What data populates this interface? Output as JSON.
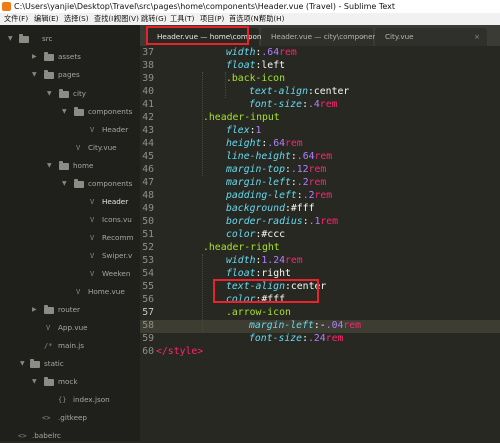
{
  "window": {
    "title": "C:\\Users\\yanjie\\Desktop\\Travel\\src\\pages\\home\\components\\Header.vue (Travel) - Sublime Text"
  },
  "menu": {
    "items": [
      "文件(F)",
      "编辑(E)",
      "选择(S)",
      "查找(I)",
      "视图(V)",
      "跳转(G)",
      "工具(T)",
      "项目(P)",
      "首选项(N)",
      "帮助(H)"
    ]
  },
  "sidebar": {
    "items": [
      {
        "label": "src",
        "kind": "folder",
        "expanded": true
      },
      {
        "label": "assets",
        "kind": "folder",
        "expanded": false
      },
      {
        "label": "pages",
        "kind": "folder",
        "expanded": true
      },
      {
        "label": "city",
        "kind": "folder",
        "expanded": true
      },
      {
        "label": "components",
        "kind": "folder",
        "expanded": true
      },
      {
        "label": "Header",
        "kind": "file",
        "glyph": "V"
      },
      {
        "label": "City.vue",
        "kind": "file",
        "glyph": "V"
      },
      {
        "label": "home",
        "kind": "folder",
        "expanded": true
      },
      {
        "label": "components",
        "kind": "folder",
        "expanded": true
      },
      {
        "label": "Header",
        "kind": "file",
        "glyph": "V",
        "active": true
      },
      {
        "label": "Icons.vu",
        "kind": "file",
        "glyph": "V"
      },
      {
        "label": "Recomm",
        "kind": "file",
        "glyph": "V"
      },
      {
        "label": "Swiper.v",
        "kind": "file",
        "glyph": "V"
      },
      {
        "label": "Weeken",
        "kind": "file",
        "glyph": "V"
      },
      {
        "label": "Home.vue",
        "kind": "file",
        "glyph": "V"
      },
      {
        "label": "router",
        "kind": "folder",
        "expanded": false
      },
      {
        "label": "App.vue",
        "kind": "file",
        "glyph": "V"
      },
      {
        "label": "main.js",
        "kind": "file",
        "glyph": "/*"
      },
      {
        "label": "static",
        "kind": "folder",
        "expanded": true
      },
      {
        "label": "mock",
        "kind": "folder",
        "expanded": true
      },
      {
        "label": "index.json",
        "kind": "file",
        "glyph": "{}"
      },
      {
        "label": ".gitkeep",
        "kind": "file",
        "glyph": "<>"
      },
      {
        "label": ".babelrc",
        "kind": "file",
        "glyph": "<>"
      }
    ]
  },
  "tabs": [
    {
      "label": "Header.vue — home\\components",
      "close": "×",
      "active": true
    },
    {
      "label": "Header.vue — city\\components",
      "close": "×",
      "active": false
    },
    {
      "label": "City.vue",
      "close": "×",
      "active": false
    }
  ],
  "editor": {
    "current_line": "57",
    "lines": [
      {
        "num": "37",
        "tokens": [
          {
            "t": "width",
            "c": "prop"
          },
          {
            "t": ":",
            "c": "punct"
          },
          {
            "t": ".64",
            "c": "num"
          },
          {
            "t": "rem",
            "c": "unit"
          }
        ]
      },
      {
        "num": "38",
        "tokens": [
          {
            "t": "float",
            "c": "prop"
          },
          {
            "t": ":left",
            "c": "val"
          }
        ]
      },
      {
        "num": "39",
        "tokens": [
          {
            "t": ".back-icon",
            "c": "sel"
          }
        ]
      },
      {
        "num": "40",
        "tokens": [
          {
            "t": "text-align",
            "c": "prop"
          },
          {
            "t": ":center",
            "c": "val"
          }
        ]
      },
      {
        "num": "41",
        "tokens": [
          {
            "t": "font-size",
            "c": "prop"
          },
          {
            "t": ":",
            "c": "punct"
          },
          {
            "t": ".4",
            "c": "num"
          },
          {
            "t": "rem",
            "c": "unit"
          }
        ]
      },
      {
        "num": "42",
        "tokens": [
          {
            "t": ".header-input",
            "c": "sel"
          }
        ]
      },
      {
        "num": "43",
        "tokens": [
          {
            "t": "flex",
            "c": "prop"
          },
          {
            "t": ":",
            "c": "punct"
          },
          {
            "t": "1",
            "c": "num"
          }
        ]
      },
      {
        "num": "44",
        "tokens": [
          {
            "t": "height",
            "c": "prop"
          },
          {
            "t": ":",
            "c": "punct"
          },
          {
            "t": ".64",
            "c": "num"
          },
          {
            "t": "rem",
            "c": "unit"
          }
        ]
      },
      {
        "num": "45",
        "tokens": [
          {
            "t": "line-height",
            "c": "prop"
          },
          {
            "t": ":",
            "c": "punct"
          },
          {
            "t": ".64",
            "c": "num"
          },
          {
            "t": "rem",
            "c": "unit"
          }
        ]
      },
      {
        "num": "46",
        "tokens": [
          {
            "t": "margin-top",
            "c": "prop"
          },
          {
            "t": ":",
            "c": "punct"
          },
          {
            "t": ".12",
            "c": "num"
          },
          {
            "t": "rem",
            "c": "unit"
          }
        ]
      },
      {
        "num": "47",
        "tokens": [
          {
            "t": "margin-left",
            "c": "prop"
          },
          {
            "t": ":",
            "c": "punct"
          },
          {
            "t": ".2",
            "c": "num"
          },
          {
            "t": "rem",
            "c": "unit"
          }
        ]
      },
      {
        "num": "48",
        "tokens": [
          {
            "t": "padding-left",
            "c": "prop"
          },
          {
            "t": ":",
            "c": "punct"
          },
          {
            "t": ".2",
            "c": "num"
          },
          {
            "t": "rem",
            "c": "unit"
          }
        ]
      },
      {
        "num": "49",
        "tokens": [
          {
            "t": "background",
            "c": "prop"
          },
          {
            "t": ":#fff",
            "c": "val"
          }
        ]
      },
      {
        "num": "50",
        "tokens": [
          {
            "t": "border-radius",
            "c": "prop"
          },
          {
            "t": ":",
            "c": "punct"
          },
          {
            "t": ".1",
            "c": "num"
          },
          {
            "t": "rem",
            "c": "unit"
          }
        ]
      },
      {
        "num": "51",
        "tokens": [
          {
            "t": "color",
            "c": "prop"
          },
          {
            "t": ":#ccc",
            "c": "val"
          }
        ]
      },
      {
        "num": "52",
        "tokens": [
          {
            "t": ".header-right",
            "c": "sel"
          }
        ]
      },
      {
        "num": "53",
        "tokens": [
          {
            "t": "width",
            "c": "prop"
          },
          {
            "t": ":",
            "c": "punct"
          },
          {
            "t": "1.24",
            "c": "num"
          },
          {
            "t": "rem",
            "c": "unit"
          }
        ]
      },
      {
        "num": "54",
        "tokens": [
          {
            "t": "float",
            "c": "prop"
          },
          {
            "t": ":right",
            "c": "val"
          }
        ]
      },
      {
        "num": "55",
        "tokens": [
          {
            "t": "text-align",
            "c": "prop"
          },
          {
            "t": ":center",
            "c": "val"
          }
        ]
      },
      {
        "num": "56",
        "tokens": [
          {
            "t": "color",
            "c": "prop"
          },
          {
            "t": ":#fff",
            "c": "val"
          }
        ]
      },
      {
        "num": "57",
        "tokens": [
          {
            "t": ".arrow-icon",
            "c": "sel"
          }
        ]
      },
      {
        "num": "58",
        "tokens": [
          {
            "t": "margin-left",
            "c": "prop"
          },
          {
            "t": ":-",
            "c": "punct"
          },
          {
            "t": ".04",
            "c": "num"
          },
          {
            "t": "rem",
            "c": "unit"
          }
        ]
      },
      {
        "num": "59",
        "tokens": [
          {
            "t": "font-size",
            "c": "prop"
          },
          {
            "t": ":",
            "c": "punct"
          },
          {
            "t": ".24",
            "c": "num"
          },
          {
            "t": "rem",
            "c": "unit"
          }
        ]
      },
      {
        "num": "60",
        "tokens": [
          {
            "t": "</",
            "c": "tag"
          },
          {
            "t": "style",
            "c": "tag"
          },
          {
            "t": ">",
            "c": "tag"
          }
        ]
      }
    ]
  },
  "colors": {
    "editor_bg": "#272822",
    "sidebar_bg": "#1f201c",
    "selector": "#a6e22e",
    "property": "#66d9ef",
    "number": "#ae81ff",
    "unit": "#f92672",
    "annotation_box": "#e8232d"
  }
}
